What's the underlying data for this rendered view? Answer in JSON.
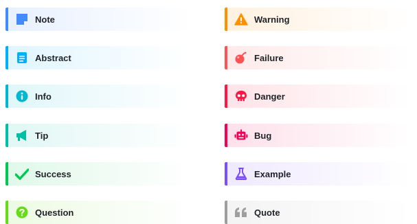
{
  "callouts": {
    "note": {
      "label": "Note",
      "icon": "note-icon",
      "color": "#448aff"
    },
    "abstract": {
      "label": "Abstract",
      "icon": "clipboard-icon",
      "color": "#00b0ff"
    },
    "info": {
      "label": "Info",
      "icon": "info-circle-icon",
      "color": "#00b8d4"
    },
    "tip": {
      "label": "Tip",
      "icon": "megaphone-icon",
      "color": "#00bfa5"
    },
    "success": {
      "label": "Success",
      "icon": "checkmark-icon",
      "color": "#00c853"
    },
    "question": {
      "label": "Question",
      "icon": "question-circle-icon",
      "color": "#64dd17"
    },
    "warning": {
      "label": "Warning",
      "icon": "warning-triangle-icon",
      "color": "#ff9100"
    },
    "failure": {
      "label": "Failure",
      "icon": "bomb-icon",
      "color": "#ff5252"
    },
    "danger": {
      "label": "Danger",
      "icon": "skull-icon",
      "color": "#ff1744"
    },
    "bug": {
      "label": "Bug",
      "icon": "robot-icon",
      "color": "#f50057"
    },
    "example": {
      "label": "Example",
      "icon": "flask-icon",
      "color": "#7c4dff"
    },
    "quote": {
      "label": "Quote",
      "icon": "quote-icon",
      "color": "#9e9e9e"
    }
  }
}
